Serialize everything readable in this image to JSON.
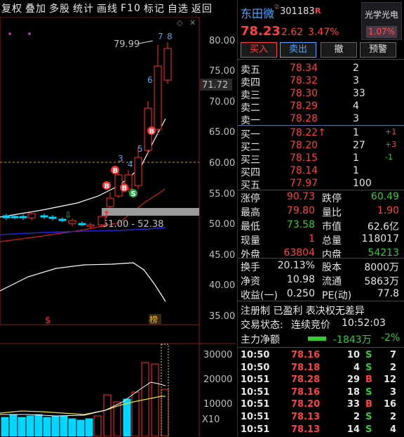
{
  "toolbar": {
    "items": [
      "复权",
      "叠加",
      "多股",
      "统计",
      "画线",
      "F10",
      "标记",
      "自选",
      "返回"
    ]
  },
  "chart": {
    "price_ticks": [
      "80.00",
      "75.00",
      "70.00",
      "65.00",
      "60.00",
      "55.00",
      "50.00",
      "45.00",
      "40.00",
      "35.00"
    ],
    "current_marker": "71.72",
    "high_label": "79.99",
    "range_label": "51.00 - 52.38",
    "volume_ticks": [
      "30000",
      "20000",
      "10000"
    ],
    "volume_unit": "X10",
    "dollar_marker": "$",
    "rank_marker": "榜",
    "seq_numbers": [
      "3",
      "4",
      "5",
      "6",
      "7",
      "8"
    ]
  },
  "stock": {
    "name": "东田微",
    "code": "301183",
    "tag": "R",
    "price": "78.23",
    "change": "2.62",
    "change_pct": "3.47%",
    "sector": "光学光电",
    "sector_pct": "1.07%"
  },
  "buttons": [
    "买入",
    "卖出",
    "撤",
    "预警"
  ],
  "order_book": {
    "asks": [
      {
        "label": "卖五",
        "price": "78.34",
        "vol": "2"
      },
      {
        "label": "卖四",
        "price": "78.32",
        "vol": "3"
      },
      {
        "label": "卖三",
        "price": "78.30",
        "vol": "33"
      },
      {
        "label": "卖二",
        "price": "78.29",
        "vol": "4"
      },
      {
        "label": "卖一",
        "price": "78.28",
        "vol": "3"
      }
    ],
    "bids": [
      {
        "label": "买一",
        "price": "78.22",
        "arrow": "↑",
        "vol": "1",
        "chg": "+1"
      },
      {
        "label": "买二",
        "price": "78.20",
        "arrow": "",
        "vol": "27",
        "chg": "+3"
      },
      {
        "label": "买三",
        "price": "78.15",
        "arrow": "",
        "vol": "1",
        "chg": "-1"
      },
      {
        "label": "买四",
        "price": "78.14",
        "arrow": "",
        "vol": "1",
        "chg": ""
      },
      {
        "label": "买五",
        "price": "77.97",
        "arrow": "",
        "vol": "100",
        "chg": ""
      }
    ]
  },
  "stats": [
    {
      "l1": "涨停",
      "v1": "90.73",
      "l2": "跌停",
      "v2": "60.49"
    },
    {
      "l1": "最高",
      "v1": "79.80",
      "l2": "量比",
      "v2": "1.90"
    },
    {
      "l1": "最低",
      "v1": "73.58",
      "l2": "市值",
      "v2": "62.6亿"
    },
    {
      "l1": "现量",
      "v1": "1",
      "l2": "总量",
      "v2": "118017"
    },
    {
      "l1": "外盘",
      "v1": "63804",
      "l2": "内盘",
      "v2": "54213"
    }
  ],
  "stats2": [
    {
      "l1": "换手",
      "v1": "20.13%",
      "l2": "股本",
      "v2": "8000万"
    },
    {
      "l1": "净资",
      "v1": "10.98",
      "l2": "流通",
      "v2": "5863万"
    },
    {
      "l1": "收益(一)",
      "v1": "0.250",
      "l2": "PE(动)",
      "v2": "77.8"
    }
  ],
  "info": {
    "tags": "注册制 已盈利 表决权无差异",
    "status_label": "交易状态:",
    "status": "连续竞价",
    "time": "10:52:03",
    "flow_label": "主力净额",
    "flow_value": "-1843万",
    "flow_pct": "-2%"
  },
  "trades": [
    {
      "t": "10:50",
      "p": "78.16",
      "v": "10",
      "d": "S",
      "n": "7"
    },
    {
      "t": "10:50",
      "p": "78.18",
      "v": "4",
      "d": "S",
      "n": "2"
    },
    {
      "t": "10:51",
      "p": "78.28",
      "v": "29",
      "d": "B",
      "n": "12"
    },
    {
      "t": "10:51",
      "p": "78.16",
      "v": "18",
      "d": "S",
      "n": "3"
    },
    {
      "t": "10:51",
      "p": "78.20",
      "v": "33",
      "d": "B",
      "n": "16"
    },
    {
      "t": "10:51",
      "p": "78.13",
      "v": "2",
      "d": "S",
      "n": "2"
    },
    {
      "t": "10:51",
      "p": "78.13",
      "v": "14",
      "d": "S",
      "n": "4"
    }
  ],
  "colors": {
    "up": "#ff4040",
    "down": "#33cc33",
    "accent": "#4da6ff",
    "vol_down": "#00d8ff"
  }
}
